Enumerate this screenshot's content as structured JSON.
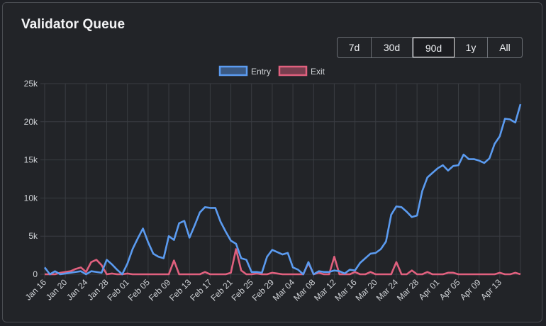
{
  "card": {
    "title": "Validator Queue"
  },
  "ranges": [
    {
      "label": "7d",
      "active": false
    },
    {
      "label": "30d",
      "active": false
    },
    {
      "label": "90d",
      "active": true
    },
    {
      "label": "1y",
      "active": false
    },
    {
      "label": "All",
      "active": false
    }
  ],
  "colors": {
    "entry": "#5b9bf0",
    "exit": "#e0607e",
    "grid": "#3a3d42",
    "text": "#cfd2d6"
  },
  "chart_data": {
    "type": "line",
    "title": "",
    "xlabel": "",
    "ylabel": "",
    "ylim": [
      0,
      25000
    ],
    "yticks": [
      0,
      5000,
      10000,
      15000,
      20000,
      25000
    ],
    "ytick_labels": [
      "0",
      "5k",
      "10k",
      "15k",
      "20k",
      "25k"
    ],
    "x_tick_labels": [
      "Jan 16",
      "Jan 20",
      "Jan 24",
      "Jan 28",
      "Feb 01",
      "Feb 05",
      "Feb 09",
      "Feb 13",
      "Feb 17",
      "Feb 21",
      "Feb 25",
      "Feb 29",
      "Mar 04",
      "Mar 08",
      "Mar 12",
      "Mar 16",
      "Mar 20",
      "Mar 24",
      "Mar 28",
      "Apr 01",
      "Apr 05",
      "Apr 09",
      "Apr 13"
    ],
    "x_start": "Jan 16",
    "x_end": "Apr 16",
    "grid": true,
    "legend_position": "top-center",
    "series": [
      {
        "name": "Entry",
        "values": [
          900,
          0,
          400,
          0,
          100,
          200,
          300,
          400,
          0,
          400,
          300,
          200,
          1900,
          1300,
          600,
          0,
          1400,
          3300,
          4700,
          6000,
          4200,
          2700,
          2300,
          2100,
          5000,
          4500,
          6700,
          7000,
          4800,
          6400,
          8100,
          8800,
          8700,
          8700,
          6900,
          5600,
          4400,
          4000,
          2100,
          1900,
          300,
          300,
          200,
          2300,
          3200,
          2900,
          2600,
          2800,
          900,
          600,
          0,
          1600,
          0,
          400,
          300,
          300,
          500,
          400,
          100,
          600,
          500,
          1500,
          2100,
          2700,
          2800,
          3300,
          4300,
          7800,
          8900,
          8800,
          8200,
          7500,
          7700,
          10900,
          12700,
          13300,
          13900,
          14300,
          13600,
          14200,
          14300,
          15700,
          15100,
          15100,
          14900,
          14600,
          15200,
          17100,
          18100,
          20400,
          20300,
          19900,
          22300
        ]
      },
      {
        "name": "Exit",
        "values": [
          0,
          0,
          0,
          200,
          300,
          400,
          700,
          900,
          300,
          1600,
          1900,
          1200,
          0,
          100,
          0,
          0,
          100,
          0,
          0,
          0,
          0,
          0,
          0,
          0,
          0,
          1800,
          0,
          0,
          0,
          0,
          0,
          300,
          0,
          0,
          0,
          0,
          200,
          3300,
          500,
          0,
          0,
          100,
          0,
          0,
          200,
          100,
          0,
          0,
          0,
          0,
          0,
          1500,
          0,
          200,
          0,
          0,
          2300,
          0,
          0,
          0,
          300,
          0,
          0,
          300,
          0,
          0,
          0,
          0,
          1600,
          0,
          0,
          500,
          0,
          0,
          300,
          0,
          0,
          0,
          200,
          200,
          0,
          0,
          0,
          0,
          0,
          0,
          0,
          0,
          200,
          0,
          0,
          200,
          0
        ]
      }
    ]
  }
}
